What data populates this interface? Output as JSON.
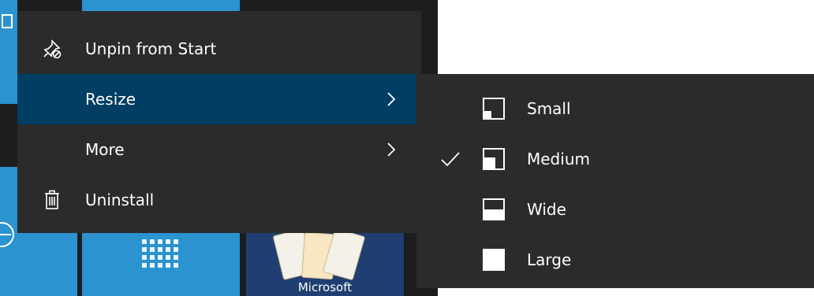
{
  "context_menu": {
    "items": [
      {
        "label": "Unpin from Start",
        "icon": "unpin-icon",
        "highlighted": false,
        "has_submenu": false
      },
      {
        "label": "Resize",
        "icon": "",
        "highlighted": true,
        "has_submenu": true
      },
      {
        "label": "More",
        "icon": "",
        "highlighted": false,
        "has_submenu": true
      },
      {
        "label": "Uninstall",
        "icon": "trash-icon",
        "highlighted": false,
        "has_submenu": false
      }
    ]
  },
  "resize_submenu": {
    "items": [
      {
        "label": "Small",
        "icon": "size-small-icon",
        "checked": false
      },
      {
        "label": "Medium",
        "icon": "size-medium-icon",
        "checked": true
      },
      {
        "label": "Wide",
        "icon": "size-wide-icon",
        "checked": false
      },
      {
        "label": "Large",
        "icon": "size-large-icon",
        "checked": false
      }
    ]
  },
  "background_tiles": {
    "solitaire_caption": "Microsoft"
  },
  "colors": {
    "menu_bg": "#2b2b2b",
    "highlight": "#003e63",
    "tile_blue": "#2b93cf",
    "tile_navy": "#1f3f72",
    "text": "#ffffff"
  }
}
